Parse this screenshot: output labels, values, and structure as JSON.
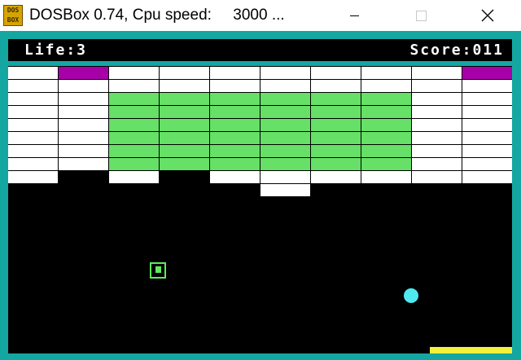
{
  "window": {
    "title": "DOSBox 0.74, Cpu speed:     3000 ...",
    "icon_text_top": "DOS",
    "icon_text_bottom": "BOX",
    "frame_color": "#14a7a2"
  },
  "hud": {
    "life_label": "Life:3",
    "score_label": "Score:011"
  },
  "game": {
    "colors": {
      "white_brick": "#ffffff",
      "green_brick": "#66e066",
      "magenta_brick": "#a800a8",
      "ball": "#4ee8f0",
      "paddle": "#f5f03a",
      "powerup": "#60e860"
    },
    "brick_columns": 10,
    "brick_rows": [
      [
        "white",
        "magenta",
        "white",
        "white",
        "white",
        "white",
        "white",
        "white",
        "white",
        "magenta"
      ],
      [
        "white",
        "white",
        "white",
        "white",
        "white",
        "white",
        "white",
        "white",
        "white",
        "white"
      ],
      [
        "white",
        "white",
        "green",
        "green",
        "green",
        "green",
        "green",
        "green",
        "white",
        "white"
      ],
      [
        "white",
        "white",
        "green",
        "green",
        "green",
        "green",
        "green",
        "green",
        "white",
        "white"
      ],
      [
        "white",
        "white",
        "green",
        "green",
        "green",
        "green",
        "green",
        "green",
        "white",
        "white"
      ],
      [
        "white",
        "white",
        "green",
        "green",
        "green",
        "green",
        "green",
        "green",
        "white",
        "white"
      ],
      [
        "white",
        "white",
        "green",
        "green",
        "green",
        "green",
        "green",
        "green",
        "white",
        "white"
      ],
      [
        "white",
        "white",
        "green",
        "green",
        "green",
        "green",
        "green",
        "green",
        "white",
        "white"
      ],
      [
        "white",
        "none",
        "white",
        "none",
        "white",
        "white",
        "white",
        "white",
        "white",
        "white"
      ],
      [
        "none",
        "none",
        "none",
        "none",
        "none",
        "white",
        "none",
        "none",
        "none",
        "none"
      ]
    ]
  }
}
